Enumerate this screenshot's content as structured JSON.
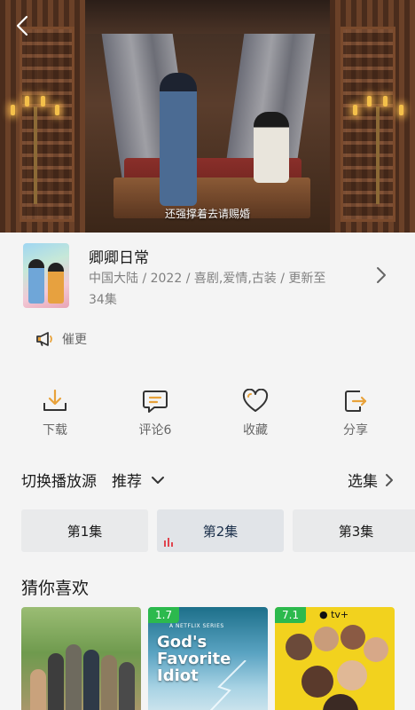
{
  "video": {
    "subtitle": "还强撑着去请赐婚"
  },
  "show": {
    "title": "卿卿日常",
    "meta_line1": "中国大陆 / 2022 / 喜剧,爱情,古装 / 更新至",
    "meta_line2": "34集"
  },
  "remind": {
    "label": "催更"
  },
  "actions": {
    "download": "下载",
    "comment": "评论6",
    "favorite": "收藏",
    "share": "分享"
  },
  "source": {
    "label": "切换播放源",
    "selected": "推荐",
    "pick_episodes": "选集"
  },
  "episodes": [
    {
      "label": "第1集"
    },
    {
      "label": "第2集"
    },
    {
      "label": "第3集"
    }
  ],
  "recommend": {
    "title": "猜你喜欢",
    "items": [
      {
        "score": ""
      },
      {
        "score": "1.7",
        "poster_title_1": "God's",
        "poster_title_2": "Favorite Idiot",
        "poster_tag": "A NETFLIX SERIES"
      },
      {
        "score": "7.1",
        "poster_brand": "tv+"
      }
    ]
  },
  "colors": {
    "score_badge": "#2cb94d",
    "icon_accent": "#e8a23a",
    "icon_stroke": "#333333"
  }
}
